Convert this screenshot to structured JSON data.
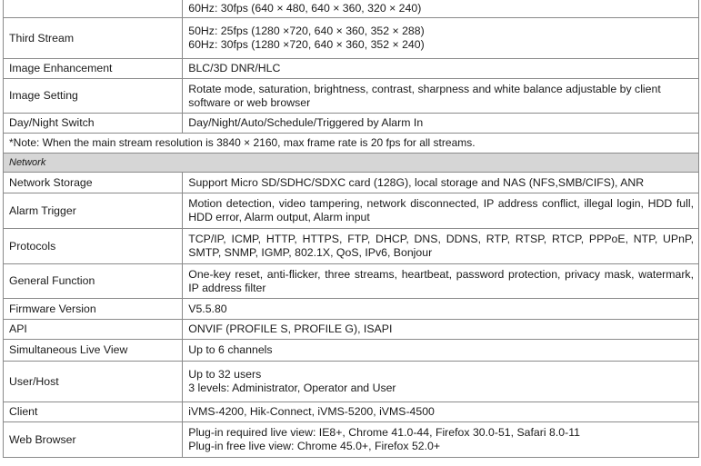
{
  "top_row": {
    "value": "60Hz: 30fps (640 × 480, 640 × 360, 320 × 240)"
  },
  "third_stream": {
    "label": "Third Stream",
    "line1": "50Hz: 25fps (1280 ×720, 640 × 360, 352 × 288)",
    "line2": "60Hz: 30fps (1280 ×720, 640 × 360, 352 × 240)"
  },
  "image_enhancement": {
    "label": "Image Enhancement",
    "value": "BLC/3D DNR/HLC"
  },
  "image_setting": {
    "label": "Image Setting",
    "value": "Rotate mode, saturation, brightness, contrast, sharpness and white balance adjustable by client software or web browser"
  },
  "day_night": {
    "label": "Day/Night Switch",
    "value": "Day/Night/Auto/Schedule/Triggered by Alarm In"
  },
  "note": "*Note: When the main stream resolution is 3840 × 2160, max frame rate is 20 fps for all streams.",
  "network_section": "Network",
  "network_storage": {
    "label": "Network Storage",
    "value": "Support Micro SD/SDHC/SDXC card (128G), local storage and NAS (NFS,SMB/CIFS), ANR"
  },
  "alarm_trigger": {
    "label": "Alarm Trigger",
    "value": "Motion detection, video tampering, network disconnected, IP address conflict, illegal login, HDD full, HDD error, Alarm output, Alarm input"
  },
  "protocols": {
    "label": "Protocols",
    "value": "TCP/IP, ICMP, HTTP, HTTPS, FTP, DHCP, DNS, DDNS, RTP, RTSP, RTCP, PPPoE, NTP, UPnP, SMTP, SNMP, IGMP, 802.1X, QoS, IPv6, Bonjour"
  },
  "general_function": {
    "label": "General Function",
    "value": "One-key reset, anti-flicker, three streams, heartbeat, password protection, privacy mask, watermark, IP address filter"
  },
  "firmware": {
    "label": "Firmware Version",
    "value": "V5.5.80"
  },
  "api": {
    "label": "API",
    "value": "ONVIF (PROFILE S, PROFILE G), ISAPI"
  },
  "live_view": {
    "label": "Simultaneous Live View",
    "value": "Up to 6 channels"
  },
  "user_host": {
    "label": "User/Host",
    "line1": "Up to 32 users",
    "line2": "3 levels: Administrator, Operator and User"
  },
  "client": {
    "label": "Client",
    "value": "iVMS-4200, Hik-Connect, iVMS-5200, iVMS-4500"
  },
  "web_browser": {
    "label": "Web Browser",
    "line1": "Plug-in required live view: IE8+, Chrome 41.0-44, Firefox 30.0-51, Safari 8.0-11",
    "line2": "Plug-in free live view: Chrome 45.0+, Firefox 52.0+"
  }
}
